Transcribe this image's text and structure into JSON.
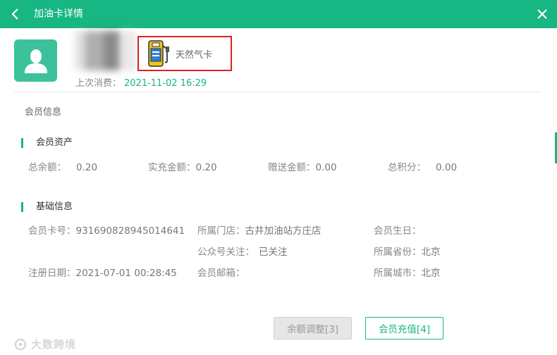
{
  "header": {
    "title": "加油卡详情"
  },
  "profile": {
    "card_type": "天然气卡",
    "last_consume_label": "上次消费：",
    "last_consume_value": "2021-11-02 16:29"
  },
  "member_info": {
    "title": "会员信息"
  },
  "assets": {
    "title": "会员资产",
    "fields": [
      {
        "label": "总余额：",
        "value": "0.20"
      },
      {
        "label": "实充金额：",
        "value": "0.20"
      },
      {
        "label": "赠送金额：",
        "value": "0.00"
      },
      {
        "label": "总积分：",
        "value": "0.00"
      }
    ]
  },
  "basic": {
    "title": "基础信息",
    "card_no_label": "会员卡号：",
    "card_no_value": "931690828945014641",
    "store_label": "所属门店：",
    "store_value": "古井加油站方庄店",
    "birthday_label": "会员生日：",
    "birthday_value": "",
    "wechat_label": "公众号关注：",
    "wechat_value": "已关注",
    "province_label": "所属省份：",
    "province_value": "北京",
    "reg_date_label": "注册日期：",
    "reg_date_value": "2021-07-01 00:28:45",
    "email_label": "会员邮箱：",
    "email_value": "",
    "city_label": "所属城市：",
    "city_value": "北京"
  },
  "actions": {
    "adjust_label": "余额调整[3]",
    "recharge_label": "会员充值[4]"
  },
  "watermark": {
    "text": "大数跨境"
  },
  "colors": {
    "accent": "#17b683",
    "highlight_border": "#e02020",
    "avatar_bg": "#3cc29b"
  },
  "icons": {
    "back": "chevron-left-icon",
    "close": "close-icon",
    "avatar": "user-icon",
    "card_type": "gas-pump-icon"
  }
}
